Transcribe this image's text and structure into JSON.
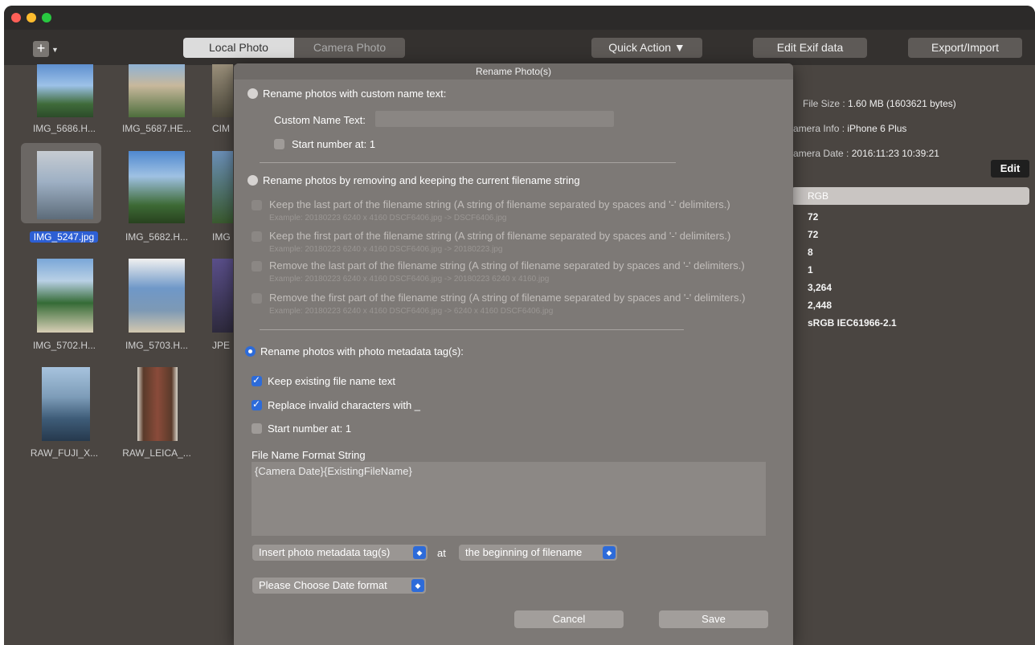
{
  "toolbar": {
    "tabs": [
      "Local Photo",
      "Camera Photo"
    ],
    "quick_action": "Quick Action ▼",
    "edit_exif": "Edit Exif data",
    "export_import": "Export/Import",
    "add": "+"
  },
  "thumbnails": [
    {
      "label": "IMG_5686.H..."
    },
    {
      "label": "IMG_5687.HE..."
    },
    {
      "label": "CIM"
    },
    {
      "label": "IMG_5247.jpg",
      "selected": true
    },
    {
      "label": "IMG_5682.H..."
    },
    {
      "label": "IMG"
    },
    {
      "label": "IMG_5702.H..."
    },
    {
      "label": "IMG_5703.H..."
    },
    {
      "label": "JPE"
    },
    {
      "label": "RAW_FUJI_X..."
    },
    {
      "label": "RAW_LEICA_..."
    }
  ],
  "info": {
    "file_size_key": "File Size :",
    "file_size_val": "1.60 MB (1603621 bytes)",
    "camera_info_key": "amera Info :",
    "camera_info_val": "iPhone 6 Plus",
    "camera_date_key": "amera Date :",
    "camera_date_val": "2016:11:23 10:39:21",
    "edit": "Edit",
    "rgb": "RGB",
    "values": [
      "72",
      "72",
      "8",
      "1",
      "3,264",
      "2,448",
      "sRGB IEC61966-2.1"
    ]
  },
  "dialog": {
    "title": "Rename Photo(s)",
    "opt1": {
      "label": "Rename photos with custom name text:",
      "custom_text_label": "Custom Name Text:",
      "custom_text_value": "",
      "start_number": "Start number at: 1"
    },
    "opt2": {
      "label": "Rename photos by removing and keeping the current filename string",
      "items": [
        {
          "text": "Keep the last part of the filename string (A string of filename separated by spaces and '-' delimiters.)",
          "example": "Example: 20180223  6240 x 4160 DSCF6406.jpg  ->  DSCF6406.jpg"
        },
        {
          "text": "Keep the first part of the filename string (A string of filename separated by spaces and '-' delimiters.)",
          "example": "Example: 20180223  6240 x 4160 DSCF6406.jpg  ->  20180223.jpg"
        },
        {
          "text": "Remove the last part of the filename string (A string of filename separated by spaces and '-' delimiters.)",
          "example": "Example: 20180223  6240 x 4160 DSCF6406.jpg  ->  20180223  6240 x 4160.jpg"
        },
        {
          "text": "Remove the first part of the filename string (A string of filename separated by spaces and '-' delimiters.)",
          "example": "Example: 20180223  6240 x 4160 DSCF6406.jpg  ->  6240 x 4160 DSCF6406.jpg"
        }
      ]
    },
    "opt3": {
      "label": "Rename photos with photo metadata tag(s):",
      "keep_existing": "Keep existing file name text",
      "replace_invalid": "Replace invalid characters with _",
      "start_number": "Start number at: 1",
      "format_label": "File Name Format String",
      "format_value": "{Camera Date}{ExistingFileName}",
      "insert_popup": "Insert photo metadata tag(s)",
      "at": "at",
      "position_popup": "the beginning of filename",
      "date_popup": "Please Choose Date format"
    },
    "cancel": "Cancel",
    "save": "Save"
  },
  "colors": {
    "accent": "#2d6bd9",
    "window_bg": "#4a4541",
    "dialog_bg": "#7d7976"
  }
}
